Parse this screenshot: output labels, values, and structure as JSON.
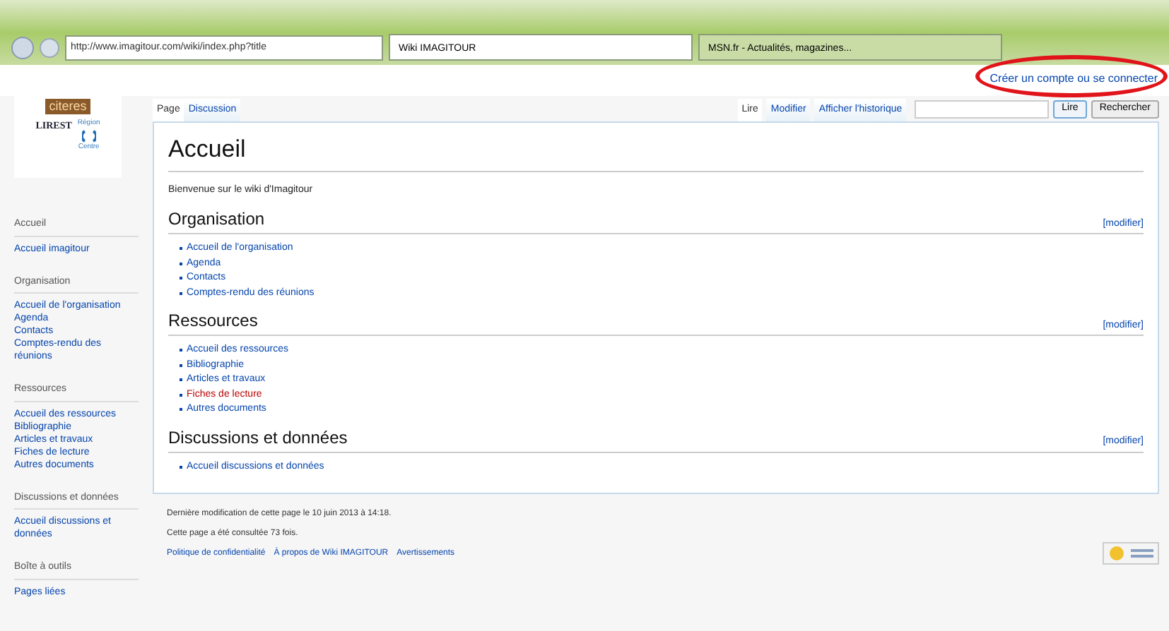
{
  "browser": {
    "address": "http://www.imagitour.com/wiki/index.php?title",
    "tabs": [
      {
        "label": "Wiki IMAGITOUR",
        "selected": true
      },
      {
        "label": "MSN.fr - Actualités, magazines...",
        "selected": false
      }
    ]
  },
  "personal_link": "Créer un compte ou se connecter",
  "logo": {
    "brand": "citeres",
    "lab": "LIREST",
    "region": "Région",
    "centre": "Centre"
  },
  "sidebar": [
    {
      "heading": "Accueil",
      "items": [
        "Accueil imagitour"
      ]
    },
    {
      "heading": "Organisation",
      "items": [
        "Accueil de l'organisation",
        "Agenda",
        "Contacts",
        "Comptes-rendu des réunions"
      ]
    },
    {
      "heading": "Ressources",
      "items": [
        "Accueil des ressources",
        "Bibliographie",
        "Articles et travaux",
        "Fiches de lecture",
        "Autres documents"
      ]
    },
    {
      "heading": "Discussions et données",
      "items": [
        "Accueil discussions et données"
      ]
    },
    {
      "heading": "Boîte à outils",
      "items": [
        "Pages liées"
      ]
    }
  ],
  "left_tabs": [
    {
      "label": "Page",
      "selected": true
    },
    {
      "label": "Discussion",
      "selected": false
    }
  ],
  "right_tabs": [
    {
      "label": "Lire",
      "selected": true
    },
    {
      "label": "Modifier",
      "selected": false
    },
    {
      "label": "Afficher l'historique",
      "selected": false
    }
  ],
  "search": {
    "buttons": [
      "Lire",
      "Rechercher"
    ]
  },
  "title": "Accueil",
  "intro": "Bienvenue sur le wiki d'Imagitour",
  "sections": [
    {
      "heading": "Organisation",
      "edit": "[modifier]",
      "links": [
        {
          "text": "Accueil de l'organisation",
          "missing": false
        },
        {
          "text": "Agenda",
          "missing": false
        },
        {
          "text": "Contacts",
          "missing": false
        },
        {
          "text": "Comptes-rendu des réunions",
          "missing": false
        }
      ]
    },
    {
      "heading": "Ressources",
      "edit": "[modifier]",
      "links": [
        {
          "text": "Accueil des ressources",
          "missing": false
        },
        {
          "text": "Bibliographie",
          "missing": false
        },
        {
          "text": "Articles et travaux",
          "missing": false
        },
        {
          "text": "Fiches de lecture",
          "missing": true
        },
        {
          "text": "Autres documents",
          "missing": false
        }
      ]
    },
    {
      "heading": "Discussions et données",
      "edit": "[modifier]",
      "links": [
        {
          "text": "Accueil discussions et données",
          "missing": false
        }
      ]
    }
  ],
  "footer": {
    "lines": [
      "Dernière modification de cette page le 10 juin 2013 à 14:18.",
      "Cette page a été consultée 73 fois."
    ],
    "links": [
      "Politique de confidentialité",
      "À propos de Wiki IMAGITOUR",
      "Avertissements"
    ]
  }
}
